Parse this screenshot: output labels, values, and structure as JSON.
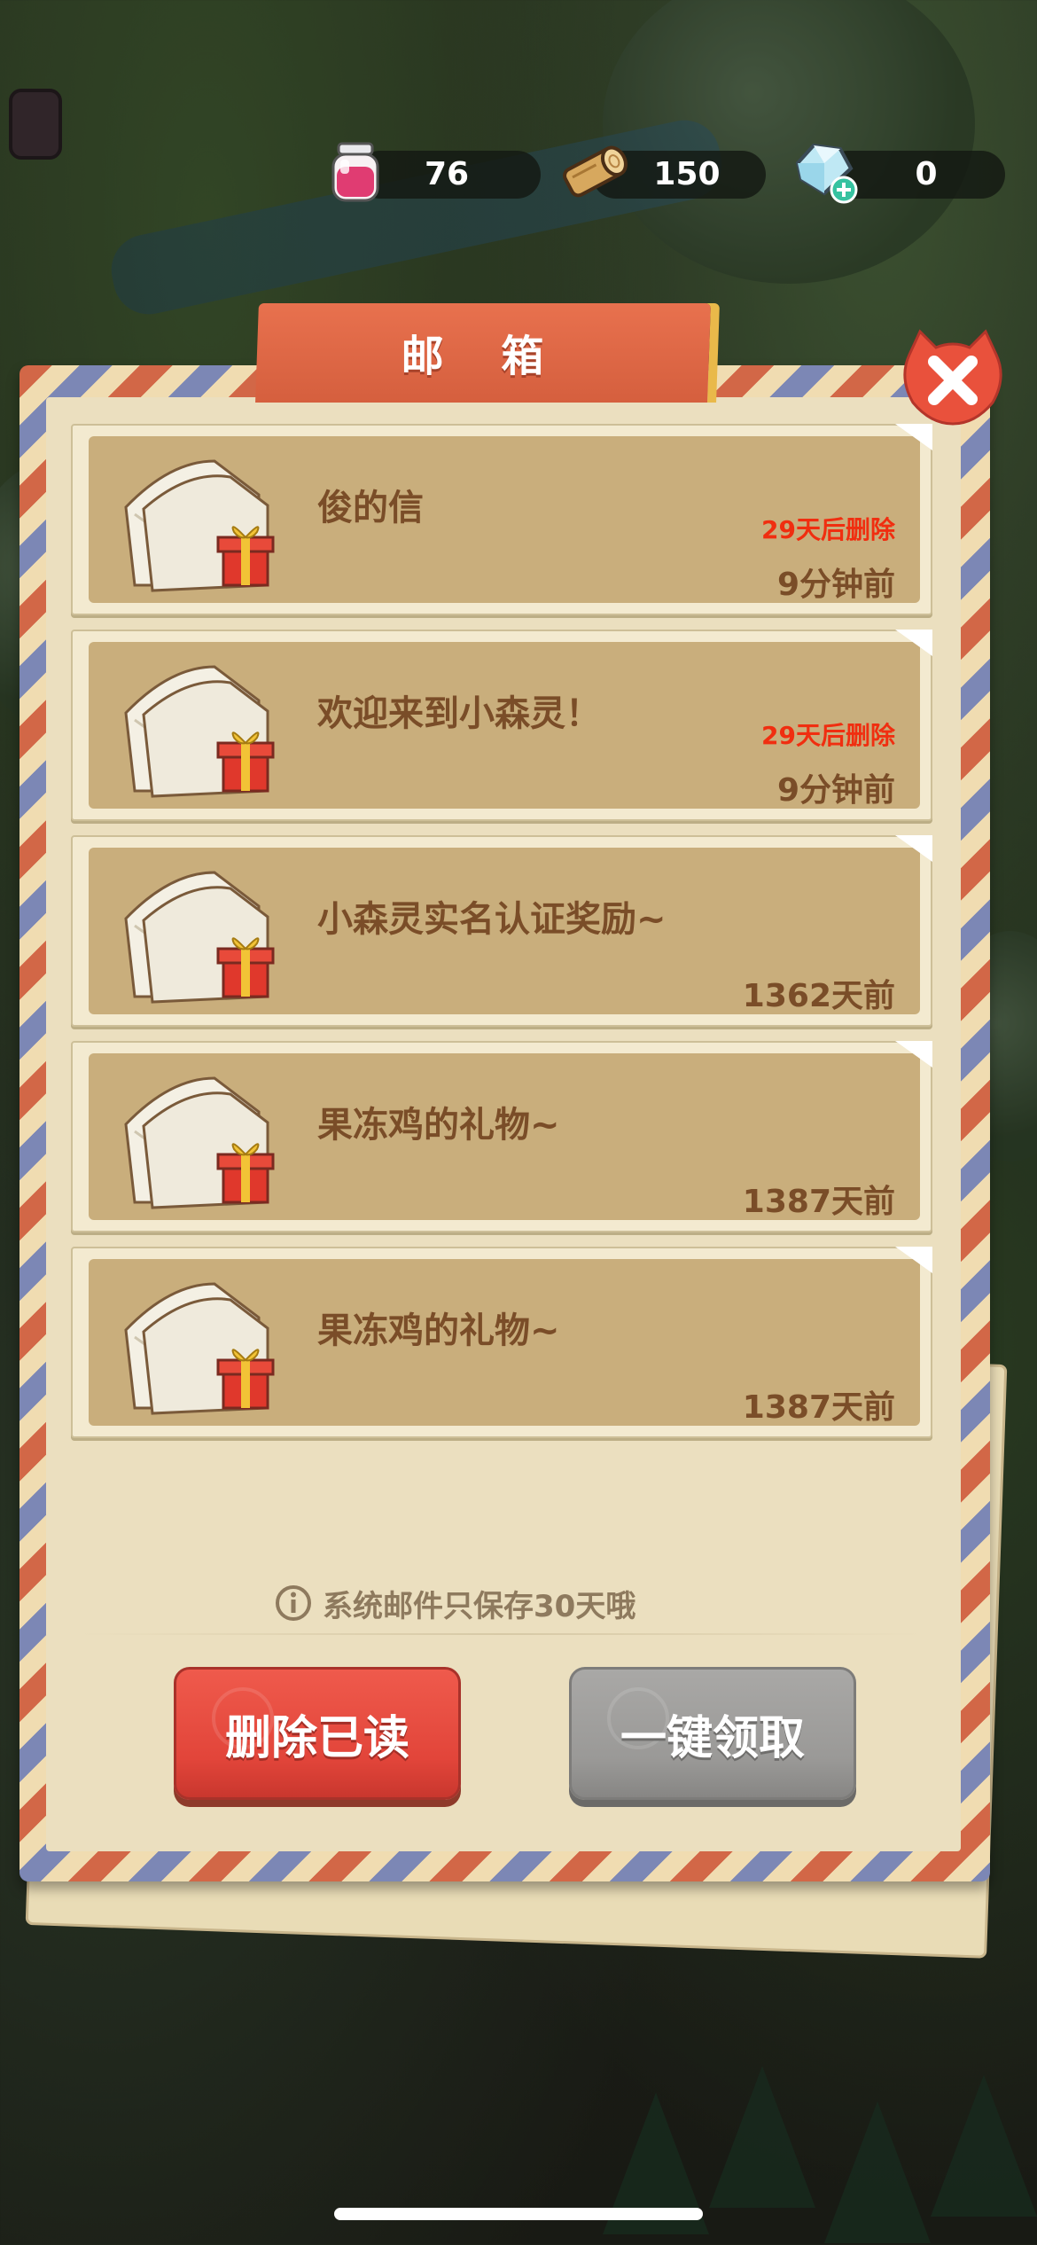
{
  "resources": [
    {
      "name": "jam",
      "icon": "jam-jar-icon",
      "value": "76"
    },
    {
      "name": "wood",
      "icon": "wood-log-icon",
      "value": "150"
    },
    {
      "name": "gem",
      "icon": "diamond-plus-icon",
      "value": "0"
    }
  ],
  "mailbox": {
    "title": "邮 箱",
    "items": [
      {
        "title": "俊的信",
        "expire": "29天后删除",
        "time": "9分钟前"
      },
      {
        "title": "欢迎来到小森灵！",
        "expire": "29天后删除",
        "time": "9分钟前"
      },
      {
        "title": "小森灵实名认证奖励~",
        "expire": "",
        "time": "1362天前"
      },
      {
        "title": "果冻鸡的礼物~",
        "expire": "",
        "time": "1387天前"
      },
      {
        "title": "果冻鸡的礼物~",
        "expire": "",
        "time": "1387天前"
      }
    ],
    "notice": "系统邮件只保存30天哦",
    "delete_read_label": "删除已读",
    "claim_all_label": "一键领取"
  },
  "colors": {
    "accent_red": "#e2453a",
    "expire_text": "#f02e10",
    "title_tab": "#e06a48",
    "disabled_gray": "#9a9997"
  }
}
